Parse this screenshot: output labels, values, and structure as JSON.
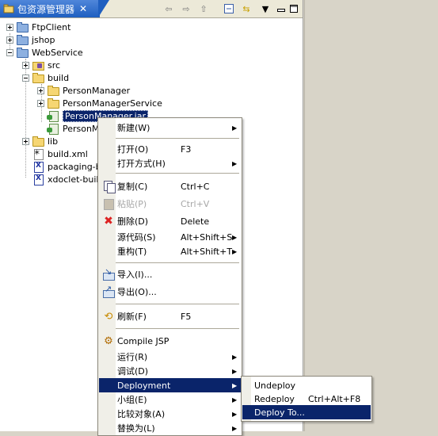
{
  "view": {
    "title": "包资源管理器",
    "close_glyph": "✕"
  },
  "tree": [
    {
      "label": "FtpClient",
      "icon": "project-icon",
      "expander": "plus"
    },
    {
      "label": "jshop",
      "icon": "project-icon",
      "expander": "plus"
    },
    {
      "label": "WebService",
      "icon": "project-icon",
      "expander": "minus"
    },
    {
      "label": "src",
      "icon": "source-folder-icon",
      "expander": "plus"
    },
    {
      "label": "build",
      "icon": "folder-icon",
      "expander": "minus"
    },
    {
      "label": "PersonManager",
      "icon": "folder-icon",
      "expander": "plus"
    },
    {
      "label": "PersonManagerService",
      "icon": "folder-icon",
      "expander": "plus"
    },
    {
      "label": "PersonManager.jar",
      "icon": "jar-icon",
      "expander": "none",
      "selected": true
    },
    {
      "label": "PersonM",
      "icon": "jar-icon",
      "expander": "none"
    },
    {
      "label": "lib",
      "icon": "folder-icon",
      "expander": "plus"
    },
    {
      "label": "build.xml",
      "icon": "ant-file-icon",
      "expander": "none"
    },
    {
      "label": "packaging-bu",
      "icon": "xdoclet-file-icon",
      "expander": "none"
    },
    {
      "label": "xdoclet-build",
      "icon": "xdoclet-file-icon",
      "expander": "none"
    }
  ],
  "context_menu": {
    "items": [
      {
        "label": "新建(W)",
        "submenu": true
      },
      {
        "label": "打开(O)",
        "accel": "F3"
      },
      {
        "label": "打开方式(H)",
        "submenu": true
      },
      {
        "label": "复制(C)",
        "accel": "Ctrl+C",
        "icon": "copy-icon"
      },
      {
        "label": "粘贴(P)",
        "accel": "Ctrl+V",
        "icon": "paste-icon",
        "disabled": true
      },
      {
        "label": "删除(D)",
        "accel": "Delete",
        "icon": "delete-icon"
      },
      {
        "label": "源代码(S)",
        "accel": "Alt+Shift+S",
        "submenu": true
      },
      {
        "label": "重构(T)",
        "accel": "Alt+Shift+T",
        "submenu": true
      },
      {
        "label": "导入(I)...",
        "icon": "import-icon"
      },
      {
        "label": "导出(O)...",
        "icon": "export-icon"
      },
      {
        "label": "刷新(F)",
        "accel": "F5",
        "icon": "refresh-icon"
      },
      {
        "label": "Compile JSP",
        "icon": "compile-jsp-icon"
      },
      {
        "label": "运行(R)",
        "submenu": true
      },
      {
        "label": "调试(D)",
        "submenu": true
      },
      {
        "label": "Deployment",
        "submenu": true,
        "active": true
      },
      {
        "label": "小组(E)",
        "submenu": true
      },
      {
        "label": "比较对象(A)",
        "submenu": true
      },
      {
        "label": "替换为(L)",
        "submenu": true
      }
    ]
  },
  "sub_menu": {
    "items": [
      {
        "label": "Undeploy"
      },
      {
        "label": "Redeploy",
        "accel": "Ctrl+Alt+F8"
      },
      {
        "label": "Deploy To...",
        "active": true
      }
    ]
  },
  "colors": {
    "selection": "#0a246a",
    "tab_blue": "#1f5fc0",
    "background": "#d8d4c8"
  }
}
